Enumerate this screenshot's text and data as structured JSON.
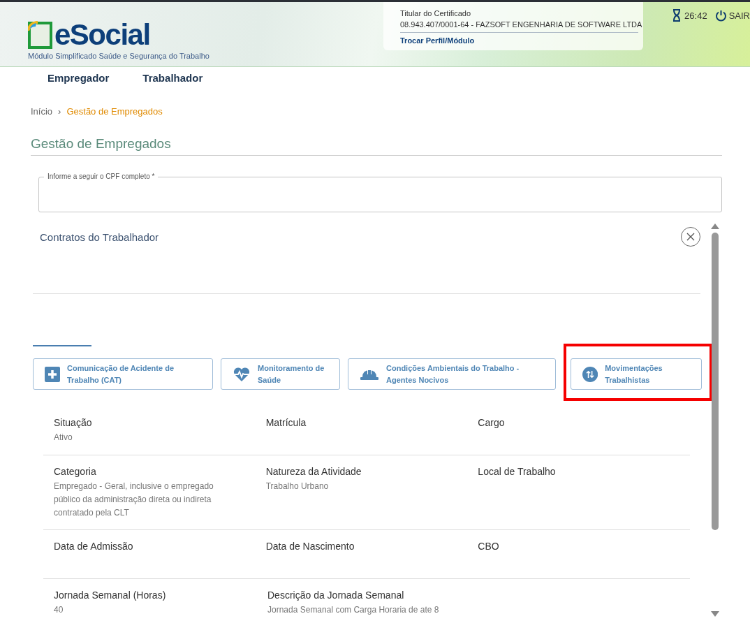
{
  "header": {
    "logo": "eSocial",
    "subtitle": "Módulo Simplificado Saúde e Segurança do Trabalho",
    "certificate": {
      "label": "Titular do Certificado",
      "holder": "08.943.407/0001-64 - FAZSOFT ENGENHARIA DE SOFTWARE LTDA",
      "switch_link": "Trocar Perfil/Módulo"
    },
    "timer": "26:42",
    "logout": "SAIR"
  },
  "nav": [
    {
      "label": "Empregador"
    },
    {
      "label": "Trabalhador"
    }
  ],
  "breadcrumb_separator": "›",
  "breadcrumb": [
    {
      "label": "Início",
      "current": false
    },
    {
      "label": "Gestão de Empregados",
      "current": true
    }
  ],
  "page_title": "Gestão de Empregados",
  "cpf_field": {
    "label": "Informe a seguir o CPF completo *"
  },
  "contracts": {
    "title": "Contratos do Trabalhador"
  },
  "actions": [
    {
      "kind": "plus",
      "label": "Comunicação de Acidente de Trabalho (CAT)",
      "highlighted": false
    },
    {
      "kind": "heart",
      "label": "Monitoramento de Saúde",
      "highlighted": false
    },
    {
      "kind": "helmet",
      "label": "Condições Ambientais do Trabalho - Agentes Nocivos",
      "highlighted": false
    },
    {
      "kind": "arrows",
      "label": "Movimentações Trabalhistas",
      "highlighted": true
    }
  ],
  "details": [
    [
      {
        "label": "Situação",
        "value": "Ativo"
      },
      {
        "label": "Matrícula"
      },
      {
        "label": "Cargo"
      }
    ],
    [
      {
        "label": "Categoria",
        "value": "Empregado - Geral, inclusive o empregado público da administração direta ou indireta contratado pela CLT"
      },
      {
        "label": "Natureza da Atividade",
        "value": "Trabalho Urbano"
      },
      {
        "label": "Local de Trabalho"
      }
    ],
    [
      {
        "label": "Data de Admissão"
      },
      {
        "label": "Data de Nascimento"
      },
      {
        "label": "CBO"
      }
    ],
    [
      {
        "label": "Jornada Semanal (Horas)",
        "value": "40"
      },
      {
        "label": "Descrição da Jornada Semanal",
        "value": "Jornada Semanal com Carga Horaria de ate 8"
      }
    ]
  ]
}
